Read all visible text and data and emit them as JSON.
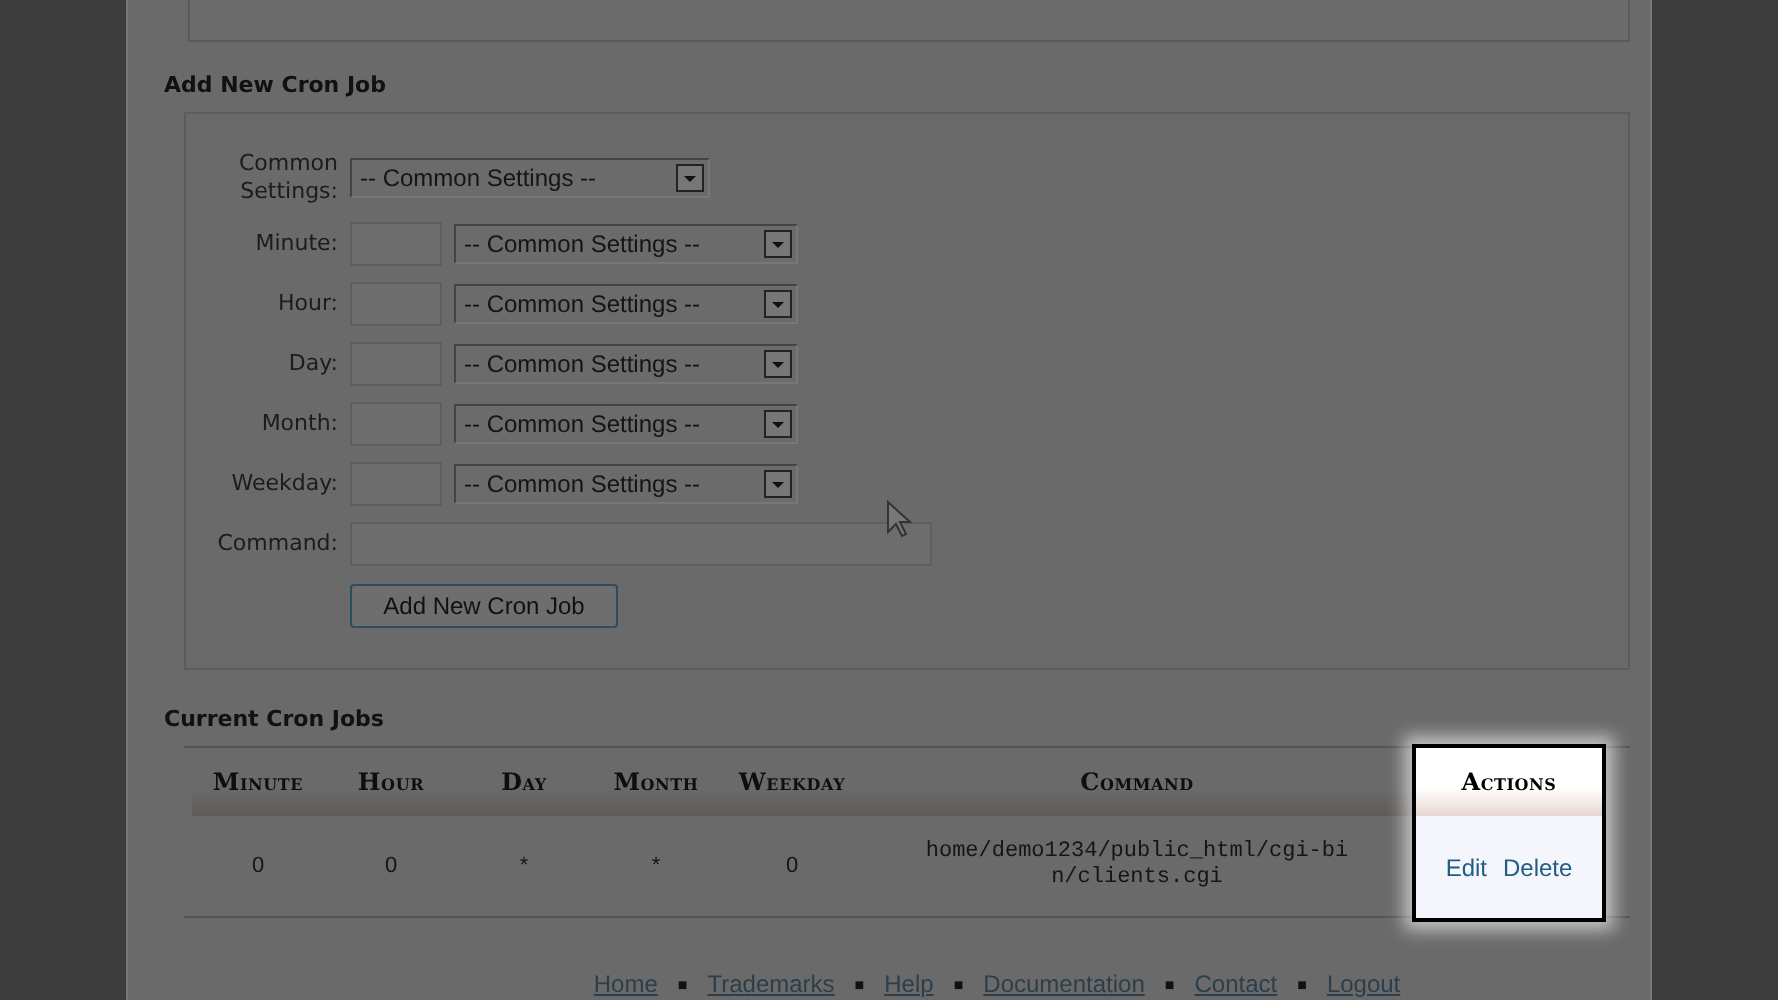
{
  "add_form": {
    "title": "Add New Cron Job",
    "common": {
      "label": "Common Settings:",
      "value": "-- Common Settings --"
    },
    "fields": [
      {
        "label": "Minute:",
        "select": "-- Common Settings --"
      },
      {
        "label": "Hour:",
        "select": "-- Common Settings --"
      },
      {
        "label": "Day:",
        "select": "-- Common Settings --"
      },
      {
        "label": "Month:",
        "select": "-- Common Settings --"
      },
      {
        "label": "Weekday:",
        "select": "-- Common Settings --"
      }
    ],
    "command": {
      "label": "Command:"
    },
    "submit": "Add New Cron Job"
  },
  "current": {
    "title": "Current Cron Jobs",
    "columns": [
      {
        "label": "Minute",
        "kind": "text",
        "highlighted": false
      },
      {
        "label": "Hour",
        "kind": "text",
        "highlighted": false
      },
      {
        "label": "Day",
        "kind": "text",
        "highlighted": false
      },
      {
        "label": "Month",
        "kind": "text",
        "highlighted": false
      },
      {
        "label": "Weekday",
        "kind": "text",
        "highlighted": false
      },
      {
        "label": "Command",
        "kind": "command",
        "highlighted": false
      },
      {
        "label": "Actions",
        "kind": "actions",
        "highlighted": true
      }
    ],
    "rows": [
      {
        "cells": [
          "0",
          "0",
          "*",
          "*",
          "0",
          "home/demo1234/public_html/cgi-bin/clients.cgi"
        ],
        "actions": [
          "Edit",
          "Delete"
        ]
      }
    ]
  },
  "footer": {
    "separator": "■",
    "links": [
      "Home",
      "Trademarks",
      "Help",
      "Documentation",
      "Contact",
      "Logout"
    ]
  }
}
